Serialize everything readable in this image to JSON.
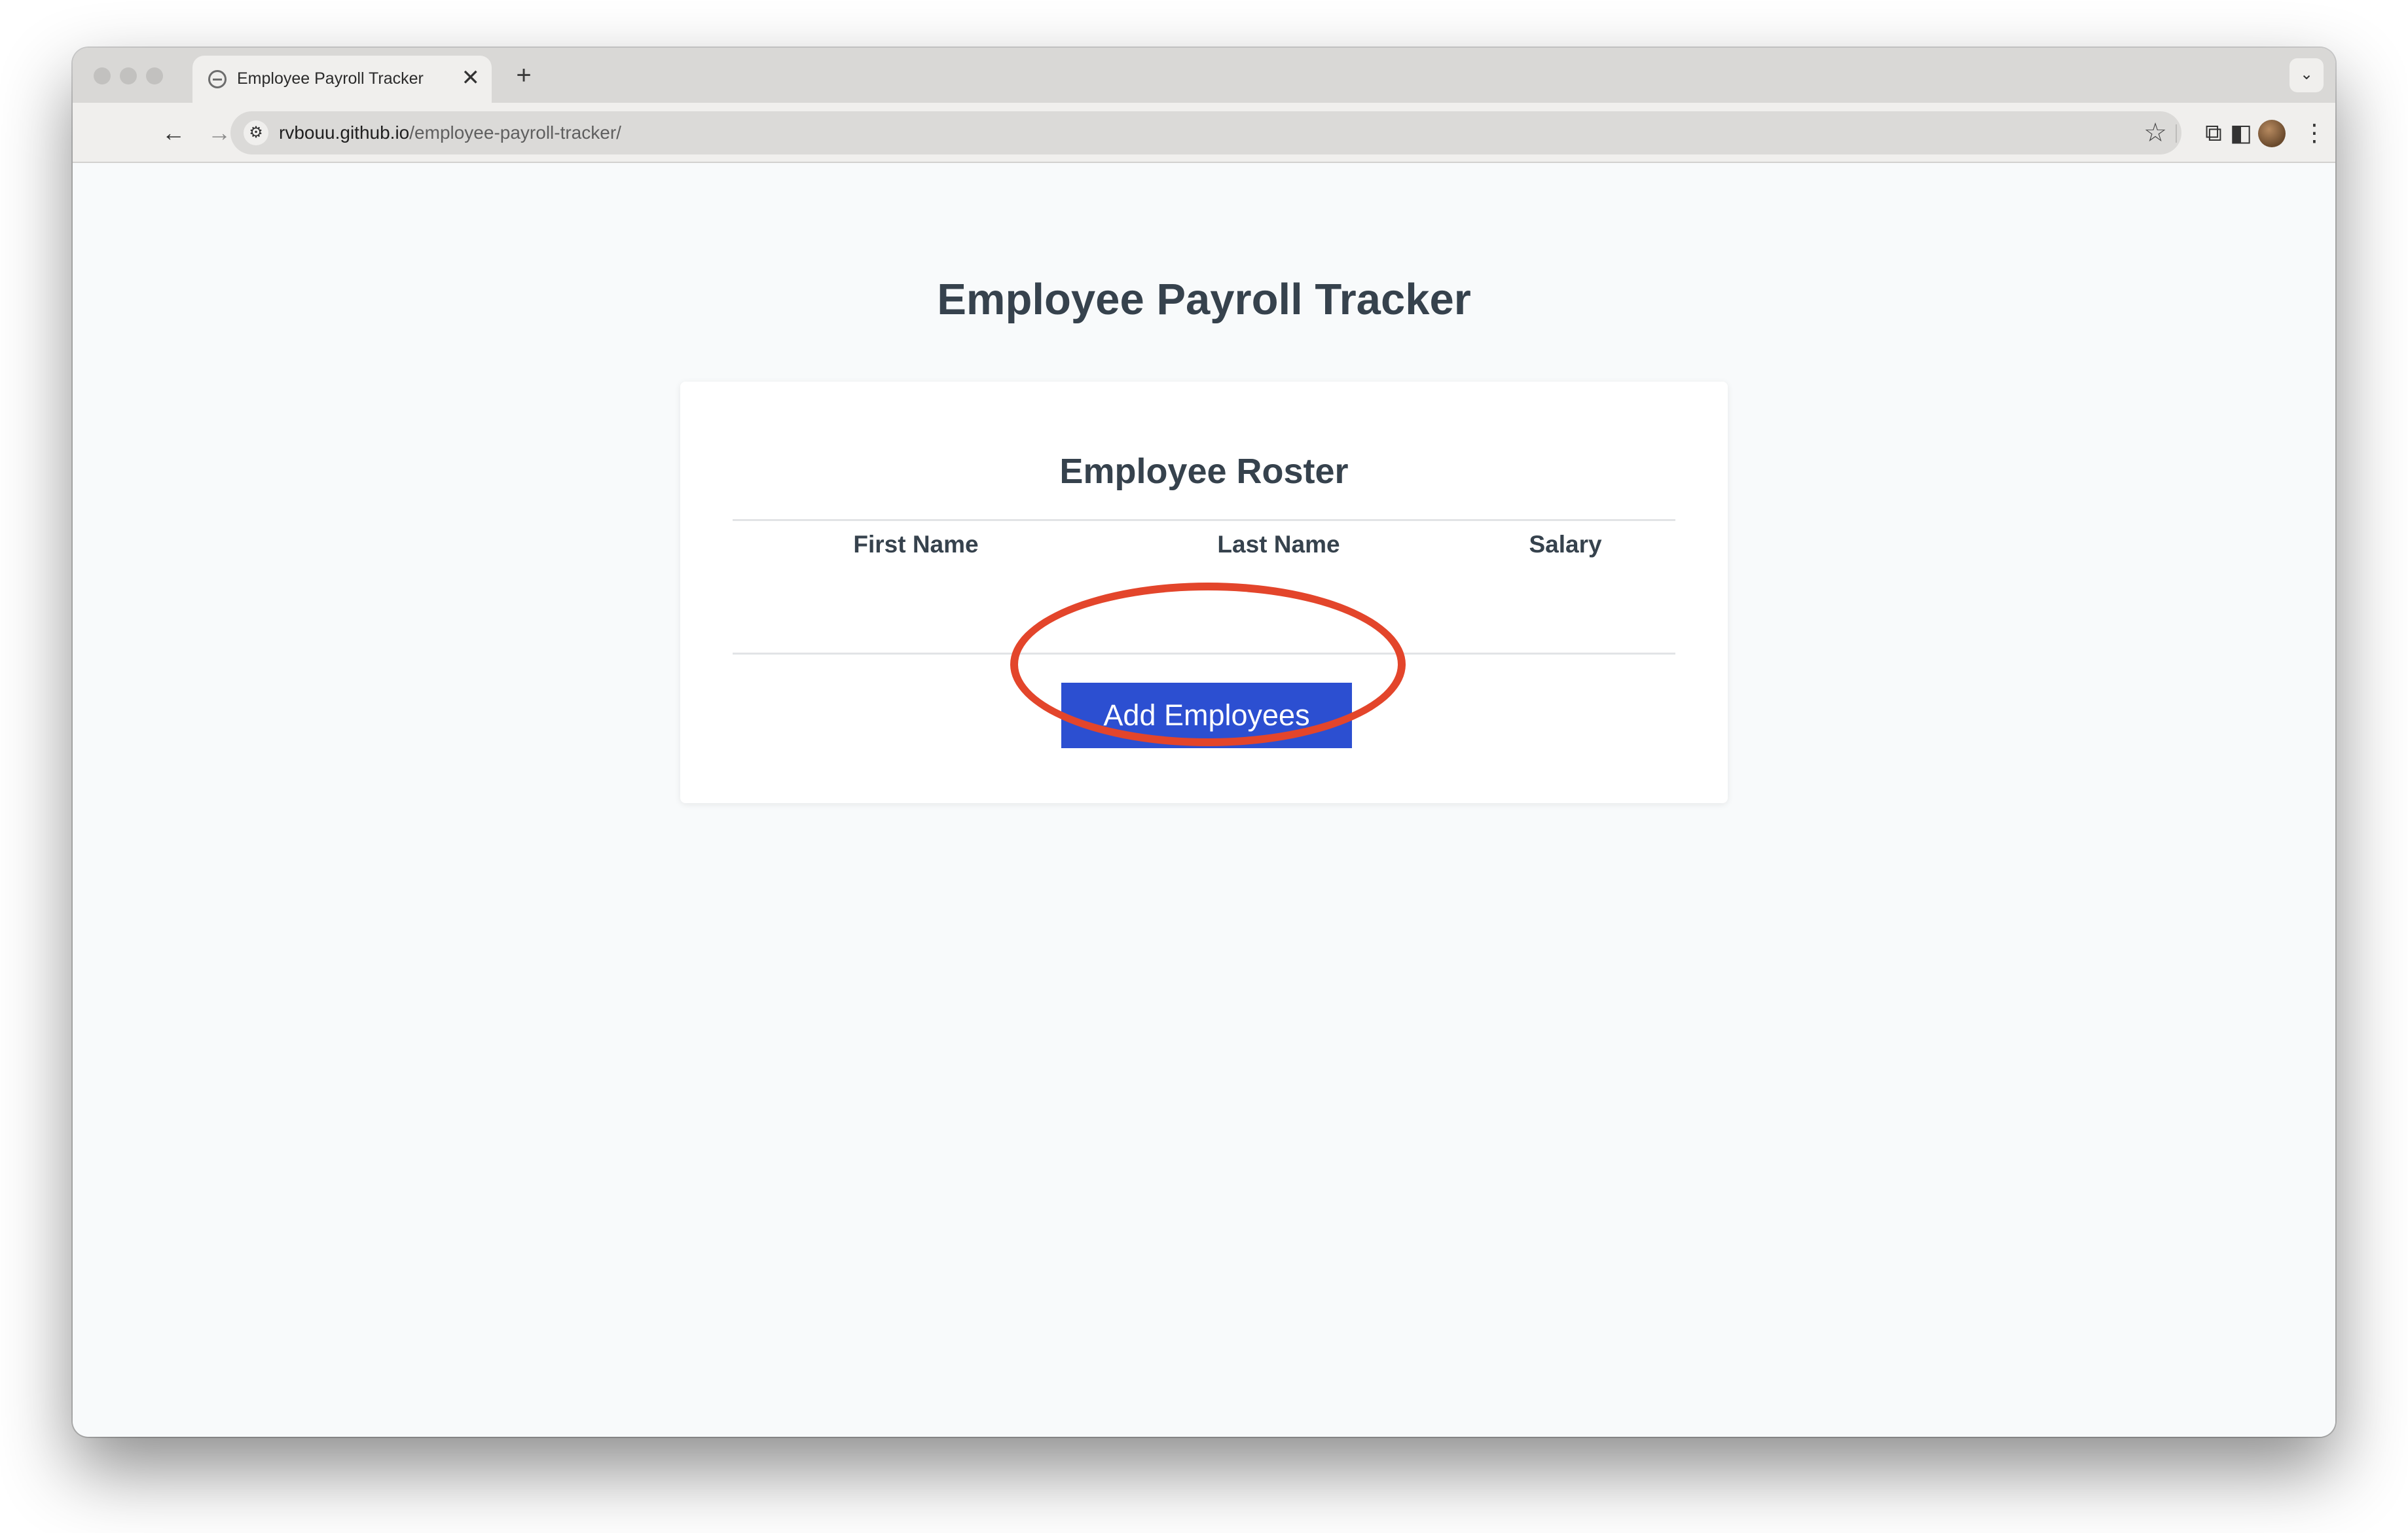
{
  "browser": {
    "tab": {
      "title": "Employee Payroll Tracker",
      "close_glyph": "✕"
    },
    "new_tab_glyph": "+",
    "tab_menu_glyph": "⌄",
    "nav": {
      "back_glyph": "←",
      "forward_glyph": "→",
      "reload_glyph": "↻"
    },
    "address": {
      "host": "rvbouu.github.io",
      "path": "/employee-payroll-tracker/"
    },
    "icons": {
      "site_settings": "tune-icon",
      "bookmark": "star-icon",
      "extensions": "puzzle-icon",
      "side_panel": "side-panel-icon",
      "profile": "avatar",
      "menu": "kebab-menu-icon"
    },
    "glyphs": {
      "tune": "⚙",
      "star": "☆",
      "extensions": "⧉",
      "side_panel": "◧",
      "menu": "⋮"
    }
  },
  "page": {
    "title": "Employee Payroll Tracker",
    "roster": {
      "title": "Employee Roster",
      "columns": [
        "First Name",
        "Last Name",
        "Salary"
      ],
      "rows": []
    },
    "add_button_label": "Add Employees"
  },
  "colors": {
    "button_bg": "#2c4fd1",
    "heading_text": "#36424d",
    "annotation": "#e3452b"
  }
}
